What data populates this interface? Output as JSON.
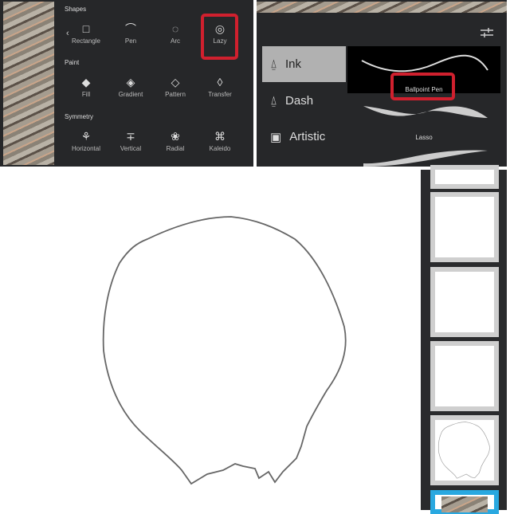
{
  "tools_panel": {
    "sections": [
      "Shapes",
      "Paint",
      "Symmetry"
    ],
    "shapes": [
      {
        "label": "Rectangle",
        "icon": "rectangle-icon"
      },
      {
        "label": "Pen",
        "icon": "pen-curve-icon"
      },
      {
        "label": "Arc",
        "icon": "arc-icon"
      },
      {
        "label": "Lazy",
        "icon": "lazy-icon",
        "highlighted": true
      }
    ],
    "paint": [
      {
        "label": "Fill",
        "icon": "fill-icon"
      },
      {
        "label": "Gradient",
        "icon": "gradient-icon"
      },
      {
        "label": "Pattern",
        "icon": "pattern-icon"
      },
      {
        "label": "Transfer",
        "icon": "transfer-icon"
      }
    ],
    "symmetry": [
      {
        "label": "Horizontal",
        "icon": "horizontal-symmetry-icon"
      },
      {
        "label": "Vertical",
        "icon": "vertical-symmetry-icon"
      },
      {
        "label": "Radial",
        "icon": "radial-symmetry-icon"
      },
      {
        "label": "Kaleido",
        "icon": "kaleido-icon"
      }
    ],
    "back_glyph": "‹"
  },
  "brush_panel": {
    "categories": [
      {
        "label": "Ink",
        "selected": true
      },
      {
        "label": "Dash"
      },
      {
        "label": "Artistic"
      }
    ],
    "brushes": [
      {
        "label": "Ballpoint Pen",
        "selected": true,
        "highlighted": true
      },
      {
        "label": "Lasso"
      }
    ]
  },
  "colors": {
    "highlight": "#d0202e",
    "panel": "#262729",
    "selected_layer": "#29a8e0"
  }
}
